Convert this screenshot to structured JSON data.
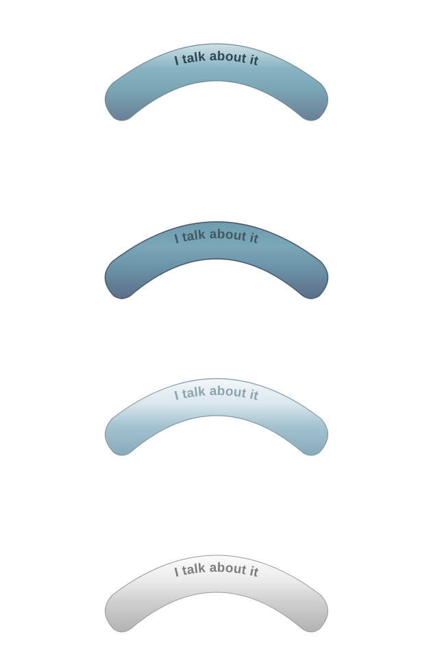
{
  "buttons": [
    {
      "state": "normal",
      "label": "I talk about it",
      "colors": {
        "top": "#cfe0e6",
        "upper": "#88b3c2",
        "mid": "#7aa5b5",
        "bottom": "#6a7f95",
        "stroke": "#6d8793",
        "text": "#2e4650"
      }
    },
    {
      "state": "pressed",
      "label": "I talk about it",
      "colors": {
        "top": "#6f9cae",
        "upper": "#7aa7b8",
        "mid": "#6a93a8",
        "bottom": "#5c6e88",
        "stroke": "#4b5f6e",
        "text": "#3f5a62"
      }
    },
    {
      "state": "hover",
      "label": "I talk about it",
      "colors": {
        "top": "#f3f7f9",
        "upper": "#dbe8ee",
        "mid": "#a6c4d1",
        "bottom": "#86aabb",
        "stroke": "#7f98a3",
        "text": "#8ea4ac"
      }
    },
    {
      "state": "disabled",
      "label": "I talk about it",
      "colors": {
        "top": "#fbfbfb",
        "upper": "#ececec",
        "mid": "#d0d0d0",
        "bottom": "#b2b2b2",
        "stroke": "#999999",
        "text": "#7d7d7d"
      }
    }
  ]
}
